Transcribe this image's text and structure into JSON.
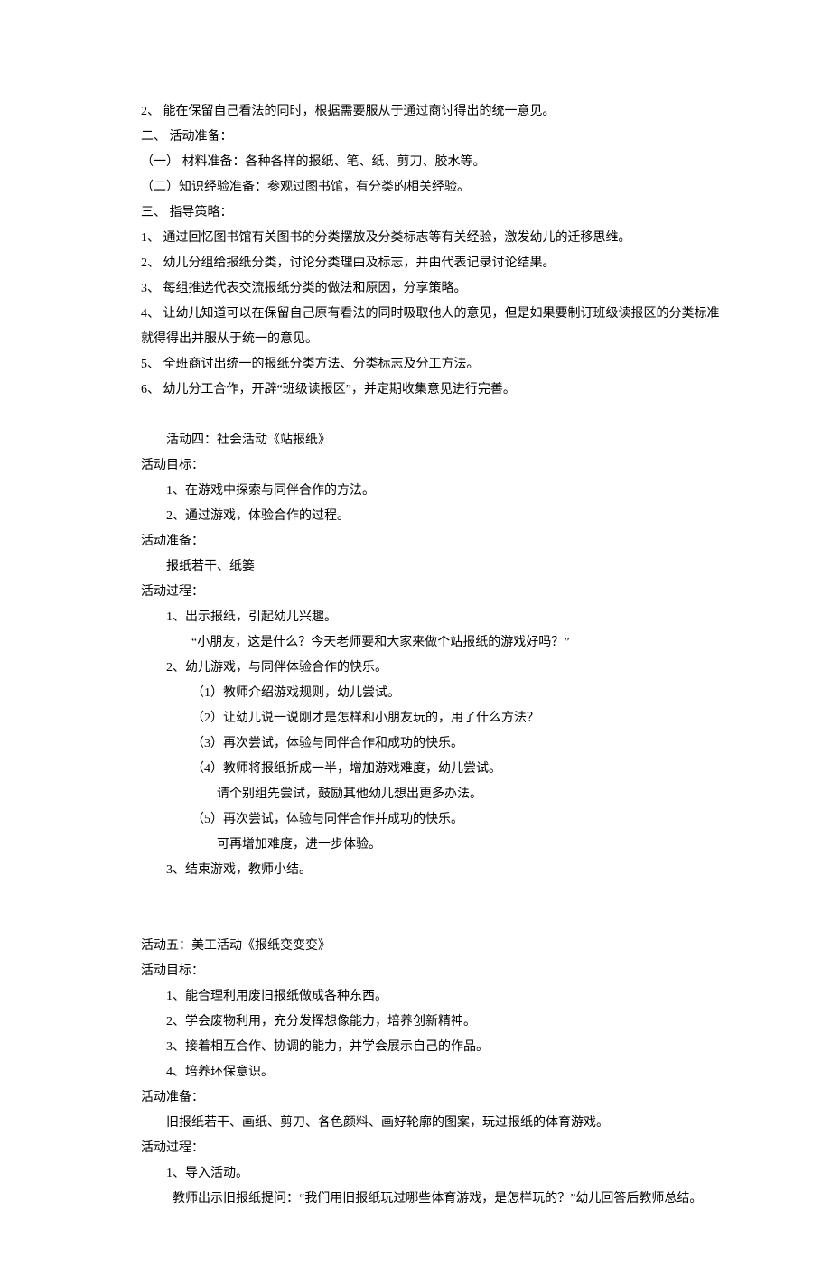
{
  "lines": [
    {
      "cls": "",
      "text": "2、 能在保留自己看法的同时，根据需要服从于通过商讨得出的统一意见。"
    },
    {
      "cls": "",
      "text": "二、 活动准备："
    },
    {
      "cls": "",
      "text": "（一） 材料准备：各种各样的报纸、笔、纸、剪刀、胶水等。"
    },
    {
      "cls": "",
      "text": "（二）知识经验准备：参观过图书馆，有分类的相关经验。"
    },
    {
      "cls": "",
      "text": "三、 指导策略："
    },
    {
      "cls": "",
      "text": "1、 通过回忆图书馆有关图书的分类摆放及分类标志等有关经验，激发幼儿的迁移思维。"
    },
    {
      "cls": "",
      "text": "2、 幼儿分组给报纸分类，讨论分类理由及标志，并由代表记录讨论结果。"
    },
    {
      "cls": "",
      "text": "3、 每组推选代表交流报纸分类的做法和原因，分享策略。"
    },
    {
      "cls": "",
      "text": "4、 让幼儿知道可以在保留自己原有看法的同时吸取他人的意见，但是如果要制订班级读报区的分类标准就得得出并服从于统一的意见。"
    },
    {
      "cls": "",
      "text": "5、 全班商讨出统一的报纸分类方法、分类标志及分工方法。"
    },
    {
      "cls": "",
      "text": "6、 幼儿分工合作，开辟“班级读报区”，并定期收集意见进行完善。"
    },
    {
      "cls": "spacer",
      "text": ""
    },
    {
      "cls": "indent1",
      "text": "活动四：社会活动《站报纸》"
    },
    {
      "cls": "",
      "text": "活动目标："
    },
    {
      "cls": "indent1",
      "text": "1、在游戏中探索与同伴合作的方法。"
    },
    {
      "cls": "indent1",
      "text": "2、通过游戏，体验合作的过程。"
    },
    {
      "cls": "",
      "text": "活动准备："
    },
    {
      "cls": "indent1",
      "text": "报纸若干、纸篓"
    },
    {
      "cls": "",
      "text": "活动过程："
    },
    {
      "cls": "indent1",
      "text": "1、出示报纸，引起幼儿兴趣。"
    },
    {
      "cls": "indent2",
      "text": "“小朋友，这是什么？今天老师要和大家来做个站报纸的游戏好吗？”"
    },
    {
      "cls": "indent1",
      "text": "2、幼儿游戏，与同伴体验合作的快乐。"
    },
    {
      "cls": "indent2",
      "text": "（1）教师介绍游戏规则，幼儿尝试。"
    },
    {
      "cls": "indent2",
      "text": "（2）让幼儿说一说刚才是怎样和小朋友玩的，用了什么方法？"
    },
    {
      "cls": "indent2",
      "text": "（3）再次尝试，体验与同伴合作和成功的快乐。"
    },
    {
      "cls": "indent2",
      "text": "（4）教师将报纸折成一半，增加游戏难度，幼儿尝试。"
    },
    {
      "cls": "indent3",
      "text": "请个别组先尝试，鼓励其他幼儿想出更多办法。"
    },
    {
      "cls": "indent2",
      "text": "（5）再次尝试，体验与同伴合作并成功的快乐。"
    },
    {
      "cls": "indent3",
      "text": "可再增加难度，进一步体验。"
    },
    {
      "cls": "indent1",
      "text": "3、结束游戏，教师小结。"
    },
    {
      "cls": "spacer",
      "text": ""
    },
    {
      "cls": "spacer",
      "text": ""
    },
    {
      "cls": "",
      "text": "活动五：美工活动《报纸变变变》"
    },
    {
      "cls": "",
      "text": "活动目标："
    },
    {
      "cls": "indent1",
      "text": "1、能合理利用废旧报纸做成各种东西。"
    },
    {
      "cls": "indent1",
      "text": "2、学会废物利用，充分发挥想像能力，培养创新精神。"
    },
    {
      "cls": "indent1",
      "text": "3、接着相互合作、协调的能力，并学会展示自己的作品。"
    },
    {
      "cls": "indent1",
      "text": "4、培养环保意识。"
    },
    {
      "cls": "",
      "text": "活动准备："
    },
    {
      "cls": "indent1",
      "text": "旧报纸若干、画纸、剪刀、各色颜料、画好轮廓的图案，玩过报纸的体育游戏。"
    },
    {
      "cls": "",
      "text": "活动过程："
    },
    {
      "cls": "indent1",
      "text": "1、导入活动。"
    },
    {
      "cls": "indent1",
      "text": "  教师出示旧报纸提问：“我们用旧报纸玩过哪些体育游戏，是怎样玩的？”幼儿回答后教师总结。"
    }
  ]
}
